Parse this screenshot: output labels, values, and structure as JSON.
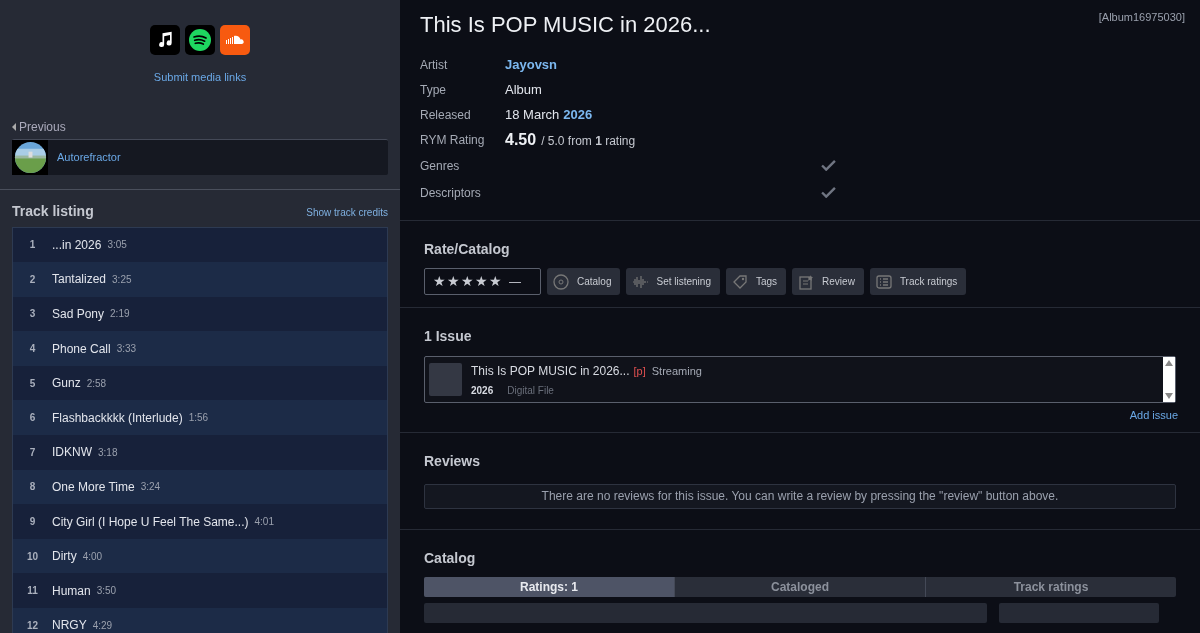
{
  "sidebar": {
    "media_links": [
      {
        "kind": "music"
      },
      {
        "kind": "spotify"
      },
      {
        "kind": "soundcloud"
      }
    ],
    "submit_link": "Submit media links",
    "previous": {
      "label": "Previous",
      "title": "Autorefractor"
    },
    "track_listing": {
      "title": "Track listing",
      "credits_link": "Show track credits",
      "tracks": [
        {
          "number": "1",
          "title": "...in 2026",
          "length": "3:05"
        },
        {
          "number": "2",
          "title": "Tantalized",
          "length": "3:25"
        },
        {
          "number": "3",
          "title": "Sad Pony",
          "length": "2:19"
        },
        {
          "number": "4",
          "title": "Phone Call",
          "length": "3:33"
        },
        {
          "number": "5",
          "title": "Gunz",
          "length": "2:58"
        },
        {
          "number": "6",
          "title": "Flashbackkkk (Interlude)",
          "length": "1:56"
        },
        {
          "number": "7",
          "title": "IDKNW",
          "length": "3:18"
        },
        {
          "number": "8",
          "title": "One More Time",
          "length": "3:24"
        },
        {
          "number": "9",
          "title": "City Girl (I Hope U Feel The Same...)",
          "length": "4:01"
        },
        {
          "number": "10",
          "title": "Dirty",
          "length": "4:00"
        },
        {
          "number": "11",
          "title": "Human",
          "length": "3:50"
        },
        {
          "number": "12",
          "title": "NRGY",
          "length": "4:29"
        }
      ]
    }
  },
  "album": {
    "title": "This Is POP MUSIC in 2026...",
    "id": "[Album16975030]",
    "info": [
      {
        "kind": "link",
        "label": "Artist",
        "value": "Jayovsn"
      },
      {
        "kind": "text",
        "label": "Type",
        "value": "Album"
      },
      {
        "kind": "date",
        "label": "Released",
        "value": "18 March",
        "year": "2026"
      },
      {
        "kind": "rating",
        "label": "RYM Rating",
        "score": "4.50",
        "value": "/ 5.0 from **1** rating"
      },
      {
        "kind": "check",
        "label": "Genres"
      },
      {
        "kind": "check",
        "label": "Descriptors"
      }
    ]
  },
  "rate_catalog": {
    "title": "Rate/Catalog",
    "stars": "★★★★★",
    "no_rating": "—",
    "buttons": [
      {
        "kind": "catalog",
        "label": "Catalog"
      },
      {
        "kind": "listening",
        "label": "Set listening"
      },
      {
        "kind": "tags",
        "label": "Tags"
      },
      {
        "kind": "review",
        "label": "Review"
      },
      {
        "kind": "tracks",
        "label": "Track ratings"
      }
    ]
  },
  "issues": {
    "title": "1 Issue",
    "items": [
      {
        "title": "This Is POP MUSIC in 2026...",
        "tag": "[p]",
        "format": "Streaming",
        "year": "2026",
        "medium": "Digital File"
      }
    ],
    "add_link": "Add issue"
  },
  "reviews": {
    "title": "Reviews",
    "empty": "There are no reviews for this issue. You can write a review by pressing the \"review\" button above."
  },
  "catalog": {
    "title": "Catalog",
    "tabs": [
      {
        "label": "**Ratings:** 1",
        "selected": true
      },
      {
        "label": "Cataloged",
        "selected": false
      },
      {
        "label": "Track ratings",
        "selected": false
      }
    ]
  }
}
